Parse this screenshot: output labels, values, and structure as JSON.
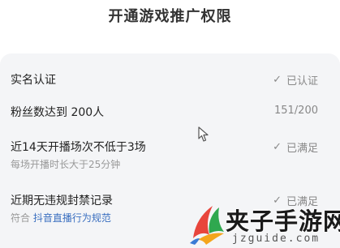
{
  "page": {
    "title": "开通游戏推广权限"
  },
  "requirements": [
    {
      "label": "实名认证",
      "status_icon": "check-icon",
      "status": "已认证"
    },
    {
      "label": "粉丝数达到 200人",
      "status": "151/200"
    },
    {
      "label": "近14天开播场次不低于3场",
      "status_icon": "check-icon",
      "status": "已满足",
      "sub": "每场开播时长大于25分钟"
    },
    {
      "label": "近期无违规封禁记录",
      "status_icon": "check-icon",
      "status": "已满足",
      "sub_prefix": "符合",
      "sub_link": "抖音直播行为规范"
    }
  ],
  "watermark": {
    "title": "夹子手游网",
    "domain": "jzguide.com"
  },
  "colors": {
    "card_background": "#f4f5f7",
    "link": "#3a6fc0",
    "muted": "#888888"
  }
}
